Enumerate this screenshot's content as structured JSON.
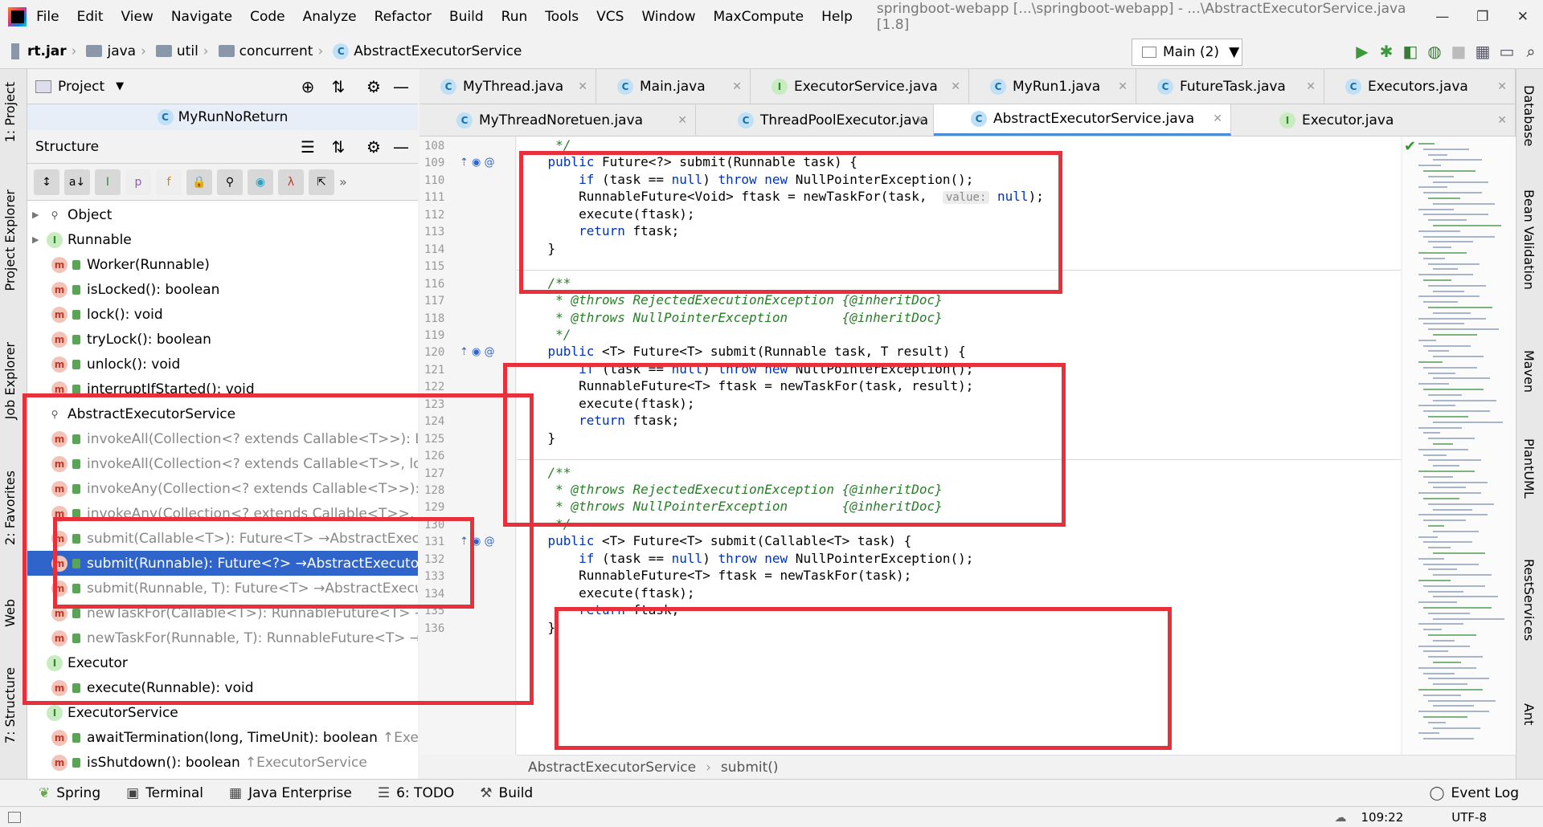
{
  "menu": {
    "items": [
      "File",
      "Edit",
      "View",
      "Navigate",
      "Code",
      "Analyze",
      "Refactor",
      "Build",
      "Run",
      "Tools",
      "VCS",
      "Window",
      "MaxCompute",
      "Help"
    ],
    "title": "springboot-webapp [...\\springboot-webapp] - ...\\AbstractExecutorService.java [1.8]"
  },
  "nav": {
    "crumbs": [
      "rt.jar",
      "java",
      "util",
      "concurrent",
      "AbstractExecutorService"
    ],
    "run_config": "Main (2)"
  },
  "left_strip": [
    "1: Project",
    "Project Explorer",
    "Job Explorer",
    "2: Favorites",
    "Web",
    "7: Structure"
  ],
  "right_strip": [
    "Database",
    "Bean Validation",
    "Maven",
    "PlantUML",
    "RestServices",
    "Ant"
  ],
  "project": {
    "header": "Project",
    "class_row": "MyRunNoReturn"
  },
  "structure": {
    "header": "Structure",
    "rows": [
      {
        "icon": "object",
        "label": "Object",
        "dim": "",
        "kind": "class"
      },
      {
        "icon": "interface",
        "label": "Runnable",
        "dim": "",
        "kind": "interface"
      },
      {
        "icon": "m",
        "label": "Worker(Runnable)",
        "dim": ""
      },
      {
        "icon": "m",
        "label": "isLocked(): boolean",
        "dim": ""
      },
      {
        "icon": "m",
        "label": "lock(): void",
        "dim": ""
      },
      {
        "icon": "m",
        "label": "tryLock(): boolean",
        "dim": ""
      },
      {
        "icon": "m",
        "label": "unlock(): void",
        "dim": ""
      },
      {
        "icon": "m",
        "label": "interruptIfStarted(): void",
        "dim": ""
      },
      {
        "icon": "class",
        "label": "AbstractExecutorService",
        "dim": ""
      },
      {
        "icon": "m",
        "label": "invokeAll(Collection<? extends Callable<T>>): L",
        "dim": "yes"
      },
      {
        "icon": "m",
        "label": "invokeAll(Collection<? extends Callable<T>>, lo",
        "dim": "yes"
      },
      {
        "icon": "m",
        "label": "invokeAny(Collection<? extends Callable<T>>):",
        "dim": "yes"
      },
      {
        "icon": "m",
        "label": "invokeAny(Collection<? extends Callable<T>>, l",
        "dim": "yes"
      },
      {
        "icon": "m",
        "label": "submit(Callable<T>): Future<T> →AbstractExecu",
        "dim": "yes"
      },
      {
        "icon": "m",
        "label": "submit(Runnable): Future<?> →AbstractExecutor",
        "dim": "",
        "selected": true
      },
      {
        "icon": "m",
        "label": "submit(Runnable, T): Future<T> →AbstractExecut",
        "dim": "yes"
      },
      {
        "icon": "m",
        "label": "newTaskFor(Callable<T>): RunnableFuture<T> →",
        "dim": "yes"
      },
      {
        "icon": "m",
        "label": "newTaskFor(Runnable, T): RunnableFuture<T> →",
        "dim": "yes"
      },
      {
        "icon": "interface",
        "label": "Executor",
        "dim": ""
      },
      {
        "icon": "m",
        "label": "execute(Runnable): void",
        "dim": ""
      },
      {
        "icon": "interface",
        "label": "ExecutorService",
        "dim": ""
      },
      {
        "icon": "m",
        "label": "awaitTermination(long, TimeUnit): boolean",
        "dim": "",
        "suffix": "↑Exec"
      },
      {
        "icon": "m",
        "label": "isShutdown(): boolean",
        "dim": "",
        "suffix": "↑ExecutorService"
      }
    ]
  },
  "tabs_row1": [
    {
      "label": "MyThread.java",
      "icon": "C"
    },
    {
      "label": "Main.java",
      "icon": "C"
    },
    {
      "label": "ExecutorService.java",
      "icon": "I"
    },
    {
      "label": "MyRun1.java",
      "icon": "C"
    },
    {
      "label": "FutureTask.java",
      "icon": "C"
    },
    {
      "label": "Executors.java",
      "icon": "C"
    }
  ],
  "tabs_row2": [
    {
      "label": "MyThreadNoretuen.java",
      "icon": "C"
    },
    {
      "label": "ThreadPoolExecutor.java",
      "icon": "C"
    },
    {
      "label": "AbstractExecutorService.java",
      "icon": "C",
      "active": true
    },
    {
      "label": "Executor.java",
      "icon": "I"
    }
  ],
  "line_numbers": [
    "108",
    "109",
    "110",
    "111",
    "112",
    "113",
    "114",
    "115",
    "116",
    "117",
    "118",
    "119",
    "120",
    "121",
    "122",
    "123",
    "124",
    "125",
    "126",
    "127",
    "128",
    "129",
    "130",
    "131",
    "132",
    "133",
    "134",
    "135",
    "136"
  ],
  "code_lines": [
    "     */",
    "    public Future<?> submit(Runnable task) {",
    "        if (task == null) throw new NullPointerException();",
    "        RunnableFuture<Void> ftask = newTaskFor(task,  value: null);",
    "        execute(ftask);",
    "        return ftask;",
    "    }",
    "",
    "    /**",
    "     * @throws RejectedExecutionException {@inheritDoc}",
    "     * @throws NullPointerException       {@inheritDoc}",
    "     */",
    "    public <T> Future<T> submit(Runnable task, T result) {",
    "        if (task == null) throw new NullPointerException();",
    "        RunnableFuture<T> ftask = newTaskFor(task, result);",
    "        execute(ftask);",
    "        return ftask;",
    "    }",
    "",
    "    /**",
    "     * @throws RejectedExecutionException {@inheritDoc}",
    "     * @throws NullPointerException       {@inheritDoc}",
    "     */",
    "    public <T> Future<T> submit(Callable<T> task) {",
    "        if (task == null) throw new NullPointerException();",
    "        RunnableFuture<T> ftask = newTaskFor(task);",
    "        execute(ftask);",
    "        return ftask;",
    "    }"
  ],
  "breadcrumb_bottom": [
    "AbstractExecutorService",
    "submit()"
  ],
  "tool_windows": [
    "Spring",
    "Terminal",
    "Java Enterprise",
    "6: TODO",
    "Build"
  ],
  "event_log": "Event Log",
  "status": {
    "position": "109:22",
    "encoding": "UTF-8"
  },
  "colors": {
    "highlight_box": "#e8303a",
    "selection": "#2f65ca",
    "keyword": "#0033b3",
    "comment": "#267f26"
  }
}
